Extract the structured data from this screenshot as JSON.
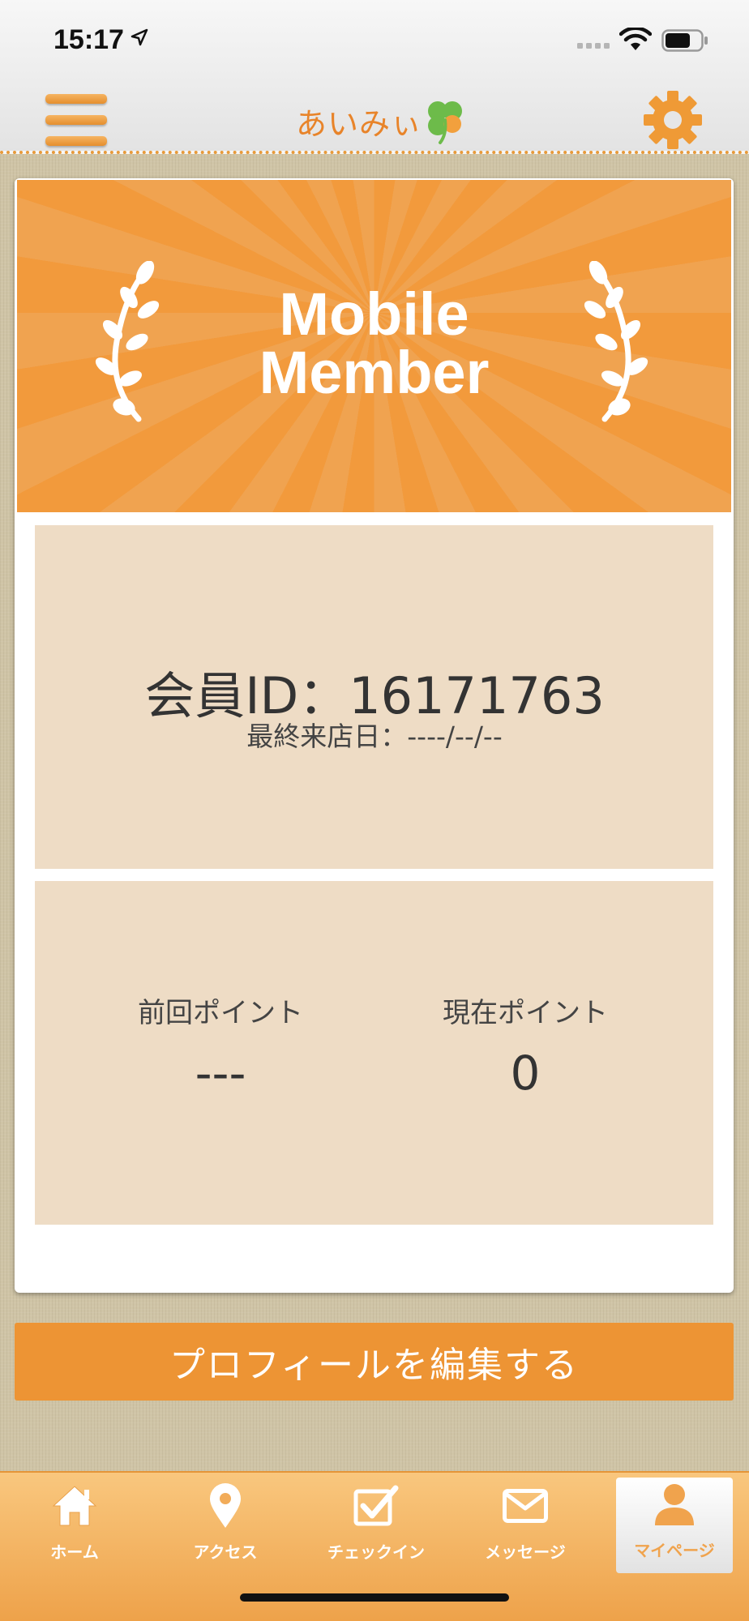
{
  "status_bar": {
    "time": "15:17"
  },
  "header": {
    "logo_text": "あいみぃ",
    "icons": [
      "menu-icon",
      "clover-icon",
      "gear-icon"
    ]
  },
  "card": {
    "banner_line1": "Mobile",
    "banner_line2": "Member",
    "member_id_line": "会員ID：16171763",
    "last_visit_line": "最終来店日：----/--/--",
    "previous_points_label": "前回ポイント",
    "previous_points_value": "---",
    "current_points_label": "現在ポイント",
    "current_points_value": "0"
  },
  "edit_profile_label": "プロフィールを編集する",
  "tabs": [
    {
      "label": "ホーム",
      "icon": "home-icon"
    },
    {
      "label": "アクセス",
      "icon": "map-pin-icon"
    },
    {
      "label": "チェックイン",
      "icon": "checkbox-icon"
    },
    {
      "label": "メッセージ",
      "icon": "envelope-icon"
    },
    {
      "label": "マイページ",
      "icon": "person-icon"
    }
  ],
  "colors": {
    "accent": "#ed9434",
    "banner_dark": "#f29a3c",
    "banner_light": "#f0a350",
    "info_box": "#eedcc5",
    "logo_text": "#e8842a",
    "clover": "#6dbb4a"
  }
}
